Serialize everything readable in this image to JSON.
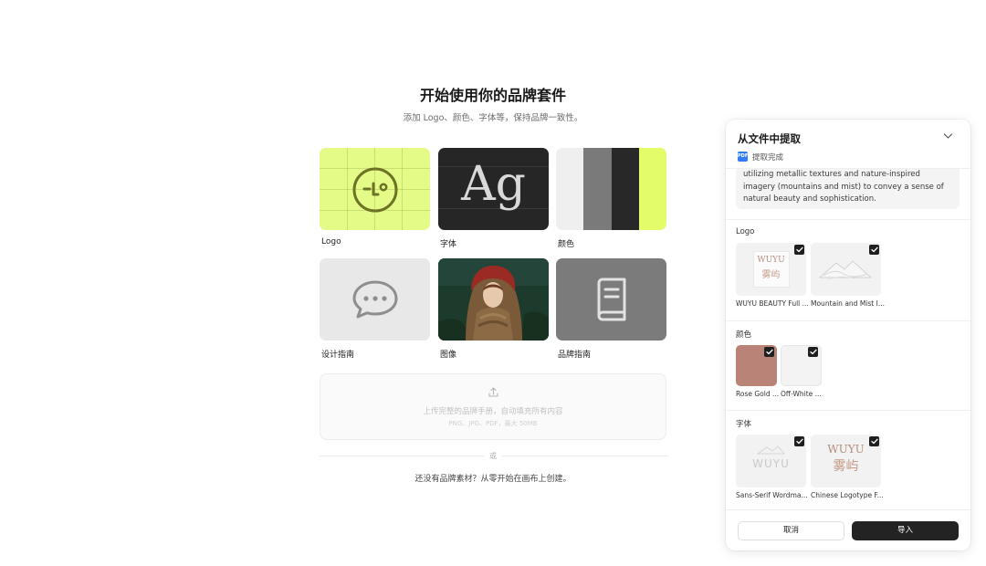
{
  "hero": {
    "title": "开始使用你的品牌套件",
    "subtitle": "添加 Logo、颜色、字体等，保持品牌一致性。"
  },
  "cards": {
    "logo": {
      "label": "Logo",
      "icon": "logo-icon",
      "color": "#e5fb88"
    },
    "font": {
      "label": "字体",
      "glyph": "Ag"
    },
    "color": {
      "label": "颜色",
      "swatches": [
        "#efefef",
        "#7a7a7a",
        "#282828",
        "#e3fc6a"
      ]
    },
    "guide": {
      "label": "设计指南",
      "icon": "chat-bubble-icon"
    },
    "image": {
      "label": "图像"
    },
    "brand_guide": {
      "label": "品牌指南",
      "icon": "book-icon"
    }
  },
  "upload": {
    "title": "上传完整的品牌手册，自动填充所有内容",
    "hint": "PNG、JPG、PDF，最大 50MB",
    "icon": "upload-icon"
  },
  "or": "或",
  "no_assets": {
    "prefix": "还没有品牌素材？",
    "link": "从零开始在画布上创建。"
  },
  "panel": {
    "title": "从文件中提取",
    "status": "提取完成",
    "status_icon_text": "PDF",
    "description": "utilizing metallic textures and nature-inspired imagery (mountains and mist) to convey a sense of natural beauty and sophistication.",
    "sections": {
      "logo": {
        "label": "Logo",
        "items": [
          {
            "label": "WUYU BEAUTY Full ...",
            "mark": "WUYU",
            "mark_cn": "雾屿"
          },
          {
            "label": "Mountain and Mist I..."
          }
        ]
      },
      "color": {
        "label": "颜色",
        "items": [
          {
            "label": "Rose Gold ...",
            "color": "#b98378"
          },
          {
            "label": "Off-White ...",
            "color": "#f3f3f3"
          }
        ]
      },
      "font": {
        "label": "字体",
        "items": [
          {
            "label": "Sans-Serif Wordma...",
            "mark": "WUYU"
          },
          {
            "label": "Chinese Logotype F...",
            "mark": "WUYU",
            "mark_cn": "雾屿"
          }
        ]
      }
    },
    "cancel": "取消",
    "import": "导入"
  }
}
